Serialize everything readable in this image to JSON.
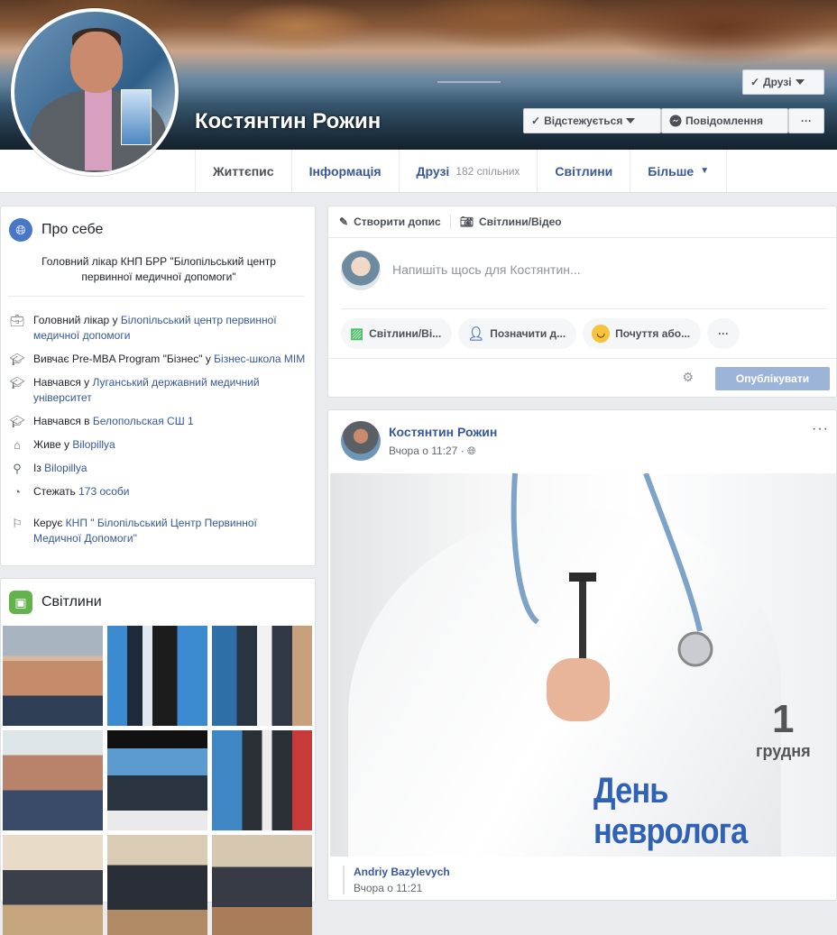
{
  "profile": {
    "name": "Костянтин Рожин",
    "friends_button": "Друзі",
    "follow_button": "Відстежується",
    "message_button": "Повідомлення",
    "more_button": "···"
  },
  "tabs": [
    {
      "label": "Життєпис",
      "active": true
    },
    {
      "label": "Інформація"
    },
    {
      "label": "Друзі",
      "sub": "182 спільних"
    },
    {
      "label": "Світлини"
    },
    {
      "label": "Більше"
    }
  ],
  "about": {
    "title": "Про себе",
    "bio": "Головний лікар КНП БРР \"Білопільський центр первинної медичної допомоги\"",
    "items": [
      {
        "icon": "briefcase-icon",
        "text": "Головний лікар у ",
        "link": "Білопільський центр первинної медичної допомоги"
      },
      {
        "icon": "graduation-cap-icon",
        "text": "Вивчає Pre-MBA Program \"Бізнес\" у ",
        "link": "Бізнес-школа MIM"
      },
      {
        "icon": "graduation-cap-icon",
        "text": "Навчався у ",
        "link": "Луганський державний медичний університет"
      },
      {
        "icon": "graduation-cap-icon",
        "text": "Навчався в ",
        "link": "Белопольская СШ 1"
      },
      {
        "icon": "home-icon",
        "text": "Живе у ",
        "link": "Bilopillya"
      },
      {
        "icon": "location-pin-icon",
        "text": "Із ",
        "link": "Bilopillya"
      },
      {
        "icon": "rss-icon",
        "text": "Стежать ",
        "link": "173 особи"
      },
      {
        "icon": "flag-icon",
        "text": "Керує ",
        "link": "КНП \" Білопільський Центр Первинної Медичної Допомоги\""
      }
    ]
  },
  "photos": {
    "title": "Світлини"
  },
  "composer": {
    "create_post": "Створити допис",
    "photo_video": "Світлини/Відео",
    "placeholder": "Напишіть щось для Костянтин...",
    "chips": [
      "Світлини/Ві...",
      "Позначити д...",
      "Почуття або..."
    ],
    "more": "···",
    "publish": "Опублікувати"
  },
  "post": {
    "author": "Костянтин Рожин",
    "time": "Вчора о 11:27 ·",
    "menu": "···",
    "image_day": "1",
    "image_month": "грудня",
    "image_title": "День невролога",
    "comment_author": "Andriy Bazylevych",
    "comment_time": "Вчора о 11:21"
  },
  "colors": {
    "link": "#365899",
    "publish_disabled": "#9cb4d8",
    "background": "#e9ebee"
  }
}
